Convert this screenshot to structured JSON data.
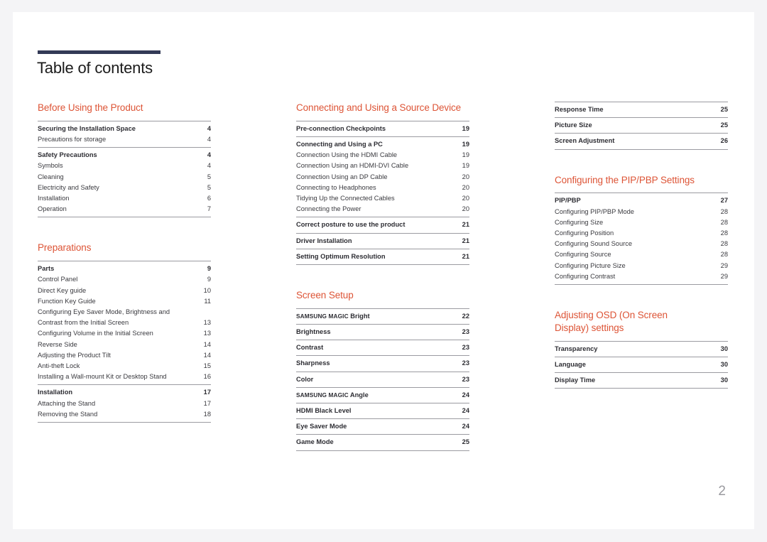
{
  "page": {
    "title": "Table of contents",
    "folio": "2",
    "accent_color": "#dd5436",
    "rule_color": "#333a56"
  },
  "columns": [
    {
      "name": "column-1",
      "sections": [
        {
          "heading": "Before Using the Product",
          "groups": [
            {
              "entries": [
                {
                  "label": "Securing the Installation Space",
                  "page": "4",
                  "bold": true
                },
                {
                  "label": "Precautions for storage",
                  "page": "4",
                  "bold": false
                }
              ]
            },
            {
              "entries": [
                {
                  "label": "Safety Precautions",
                  "page": "4",
                  "bold": true
                },
                {
                  "label": "Symbols",
                  "page": "4",
                  "bold": false
                },
                {
                  "label": "Cleaning",
                  "page": "5",
                  "bold": false
                },
                {
                  "label": "Electricity and Safety",
                  "page": "5",
                  "bold": false
                },
                {
                  "label": "Installation",
                  "page": "6",
                  "bold": false
                },
                {
                  "label": "Operation",
                  "page": "7",
                  "bold": false
                }
              ]
            }
          ]
        },
        {
          "heading": "Preparations",
          "groups": [
            {
              "entries": [
                {
                  "label": "Parts",
                  "page": "9",
                  "bold": true
                },
                {
                  "label": "Control Panel",
                  "page": "9",
                  "bold": false
                },
                {
                  "label": "Direct Key guide",
                  "page": "10",
                  "bold": false
                },
                {
                  "label": "Function Key Guide",
                  "page": "11",
                  "bold": false
                },
                {
                  "label": "Configuring Eye Saver Mode, Brightness and\nContrast from the Initial Screen",
                  "page": "13",
                  "bold": false
                },
                {
                  "label": "Configuring Volume in the Initial Screen",
                  "page": "13",
                  "bold": false
                },
                {
                  "label": "Reverse Side",
                  "page": "14",
                  "bold": false
                },
                {
                  "label": "Adjusting the Product Tilt",
                  "page": "14",
                  "bold": false
                },
                {
                  "label": "Anti-theft Lock",
                  "page": "15",
                  "bold": false
                },
                {
                  "label": "Installing a Wall-mount Kit or Desktop Stand",
                  "page": "16",
                  "bold": false
                }
              ]
            },
            {
              "entries": [
                {
                  "label": "Installation",
                  "page": "17",
                  "bold": true
                },
                {
                  "label": "Attaching the Stand",
                  "page": "17",
                  "bold": false
                },
                {
                  "label": "Removing the Stand",
                  "page": "18",
                  "bold": false
                }
              ]
            }
          ]
        }
      ]
    },
    {
      "name": "column-2",
      "sections": [
        {
          "heading": "Connecting and Using a Source Device",
          "groups": [
            {
              "entries": [
                {
                  "label": "Pre-connection Checkpoints",
                  "page": "19",
                  "bold": true
                }
              ]
            },
            {
              "entries": [
                {
                  "label": "Connecting and Using a PC",
                  "page": "19",
                  "bold": true
                },
                {
                  "label": "Connection Using the HDMI Cable",
                  "page": "19",
                  "bold": false
                },
                {
                  "label": "Connection Using an HDMI-DVI Cable",
                  "page": "19",
                  "bold": false
                },
                {
                  "label": "Connection Using an DP Cable",
                  "page": "20",
                  "bold": false
                },
                {
                  "label": "Connecting to Headphones",
                  "page": "20",
                  "bold": false
                },
                {
                  "label": "Tidying Up the Connected Cables",
                  "page": "20",
                  "bold": false
                },
                {
                  "label": "Connecting the Power",
                  "page": "20",
                  "bold": false
                }
              ]
            },
            {
              "entries": [
                {
                  "label": "Correct posture to use the product",
                  "page": "21",
                  "bold": true
                }
              ]
            },
            {
              "entries": [
                {
                  "label": "Driver Installation",
                  "page": "21",
                  "bold": true
                }
              ]
            },
            {
              "entries": [
                {
                  "label": "Setting Optimum Resolution",
                  "page": "21",
                  "bold": true
                }
              ]
            }
          ]
        },
        {
          "heading": "Screen Setup",
          "groups": [
            {
              "entries": [
                {
                  "label": "SAMSUNG MAGIC Bright",
                  "smallcaps": "SAMSUNG MAGIC",
                  "rest": " Bright",
                  "page": "22",
                  "bold": true
                }
              ]
            },
            {
              "entries": [
                {
                  "label": "Brightness",
                  "page": "23",
                  "bold": true
                }
              ]
            },
            {
              "entries": [
                {
                  "label": "Contrast",
                  "page": "23",
                  "bold": true
                }
              ]
            },
            {
              "entries": [
                {
                  "label": "Sharpness",
                  "page": "23",
                  "bold": true
                }
              ]
            },
            {
              "entries": [
                {
                  "label": "Color",
                  "page": "23",
                  "bold": true
                }
              ]
            },
            {
              "entries": [
                {
                  "label": "SAMSUNG MAGIC Angle",
                  "smallcaps": "SAMSUNG MAGIC",
                  "rest": " Angle",
                  "page": "24",
                  "bold": true
                }
              ]
            },
            {
              "entries": [
                {
                  "label": "HDMI Black Level",
                  "page": "24",
                  "bold": true
                }
              ]
            },
            {
              "entries": [
                {
                  "label": "Eye Saver Mode",
                  "page": "24",
                  "bold": true
                }
              ]
            },
            {
              "entries": [
                {
                  "label": "Game Mode",
                  "page": "25",
                  "bold": true
                }
              ]
            }
          ]
        }
      ]
    },
    {
      "name": "column-3",
      "sections": [
        {
          "heading": "",
          "groups": [
            {
              "entries": [
                {
                  "label": "Response Time",
                  "page": "25",
                  "bold": true
                }
              ]
            },
            {
              "entries": [
                {
                  "label": "Picture Size",
                  "page": "25",
                  "bold": true
                }
              ]
            },
            {
              "entries": [
                {
                  "label": "Screen Adjustment",
                  "page": "26",
                  "bold": true
                }
              ]
            }
          ]
        },
        {
          "heading": "Configuring the PIP/PBP Settings",
          "groups": [
            {
              "entries": [
                {
                  "label": "PIP/PBP",
                  "page": "27",
                  "bold": true
                },
                {
                  "label": "Configuring PIP/PBP Mode",
                  "page": "28",
                  "bold": false
                },
                {
                  "label": "Configuring Size",
                  "page": "28",
                  "bold": false
                },
                {
                  "label": "Configuring Position",
                  "page": "28",
                  "bold": false
                },
                {
                  "label": "Configuring Sound Source",
                  "page": "28",
                  "bold": false
                },
                {
                  "label": "Configuring Source",
                  "page": "28",
                  "bold": false
                },
                {
                  "label": "Configuring Picture Size",
                  "page": "29",
                  "bold": false
                },
                {
                  "label": "Configuring Contrast",
                  "page": "29",
                  "bold": false
                }
              ]
            }
          ]
        },
        {
          "heading": "Adjusting OSD (On Screen\nDisplay) settings",
          "groups": [
            {
              "entries": [
                {
                  "label": "Transparency",
                  "page": "30",
                  "bold": true
                }
              ]
            },
            {
              "entries": [
                {
                  "label": "Language",
                  "page": "30",
                  "bold": true
                }
              ]
            },
            {
              "entries": [
                {
                  "label": "Display Time",
                  "page": "30",
                  "bold": true
                }
              ]
            }
          ]
        }
      ]
    }
  ]
}
